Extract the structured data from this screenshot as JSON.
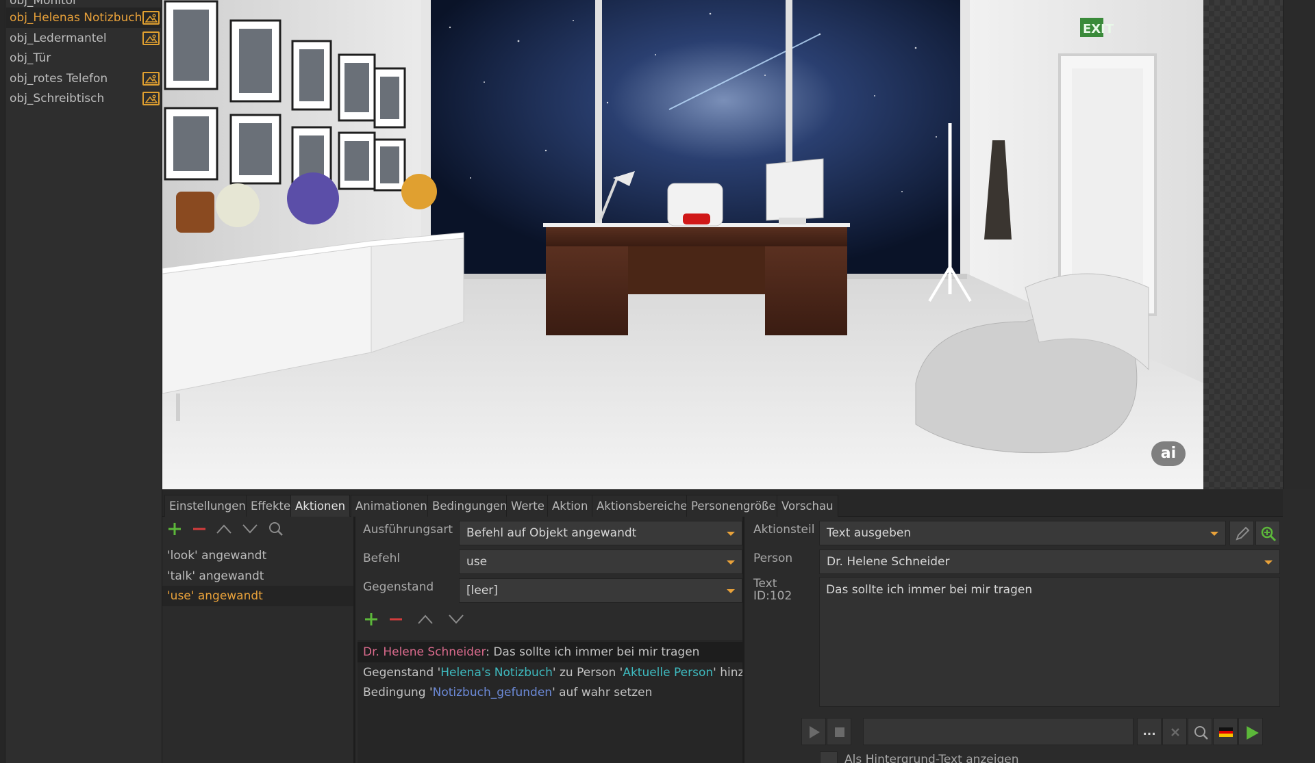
{
  "objects": {
    "items": [
      {
        "label": "obj_Monitor",
        "has_image": false
      },
      {
        "label": "obj_Helenas Notizbuch",
        "has_image": true,
        "selected": true
      },
      {
        "label": "obj_Ledermantel",
        "has_image": true
      },
      {
        "label": "obj_Tür",
        "has_image": false
      },
      {
        "label": "obj_rotes Telefon",
        "has_image": true
      },
      {
        "label": "obj_Schreibtisch",
        "has_image": true
      }
    ]
  },
  "scene": {
    "exit_sign": "EXIT",
    "badge": "ai"
  },
  "tabs": [
    {
      "label": "Einstellungen"
    },
    {
      "label": "Effekte"
    },
    {
      "label": "Aktionen",
      "active": true
    },
    {
      "label": "Animationen"
    },
    {
      "label": "Bedingungen"
    },
    {
      "label": "Werte"
    },
    {
      "label": "Aktion"
    },
    {
      "label": "Aktionsbereiche"
    },
    {
      "label": "Personengröße"
    },
    {
      "label": "Vorschau"
    }
  ],
  "actions": {
    "items": [
      {
        "label": "'look' angewandt"
      },
      {
        "label": "'talk' angewandt"
      },
      {
        "label": "'use' angewandt",
        "selected": true
      }
    ]
  },
  "execution": {
    "type_label": "Ausführungsart",
    "type_value": "Befehl auf Objekt angewandt",
    "command_label": "Befehl",
    "command_value": "use",
    "item_label": "Gegenstand",
    "item_value": "[leer]",
    "rows": {
      "r1_person": "Dr. Helene Schneider",
      "r1_text": ": Das sollte ich immer bei mir tragen",
      "r2_a": "Gegenstand '",
      "r2_item": "Helena's Notizbuch",
      "r2_b": "' zu Person '",
      "r2_person": "Aktuelle Person",
      "r2_c": "' hinzufügen",
      "r3_a": "Bedingung '",
      "r3_cond": "Notizbuch_gefunden",
      "r3_b": "' auf wahr setzen"
    }
  },
  "action_part": {
    "label": "Aktionsteil",
    "value": "Text ausgeben",
    "person_label": "Person",
    "person_value": "Dr. Helene Schneider",
    "text_label": "Text",
    "text_id": "ID:102",
    "text_value": "Das sollte ich immer bei mir tragen",
    "more_label": "...",
    "checkbox_label": "Als Hintergrund-Text anzeigen"
  },
  "colors": {
    "accent": "#e8a13a",
    "person": "#d96a8c",
    "item": "#3ebbc0",
    "condition": "#6c8ad8",
    "add": "#5cb83a",
    "remove": "#d43c3c"
  }
}
